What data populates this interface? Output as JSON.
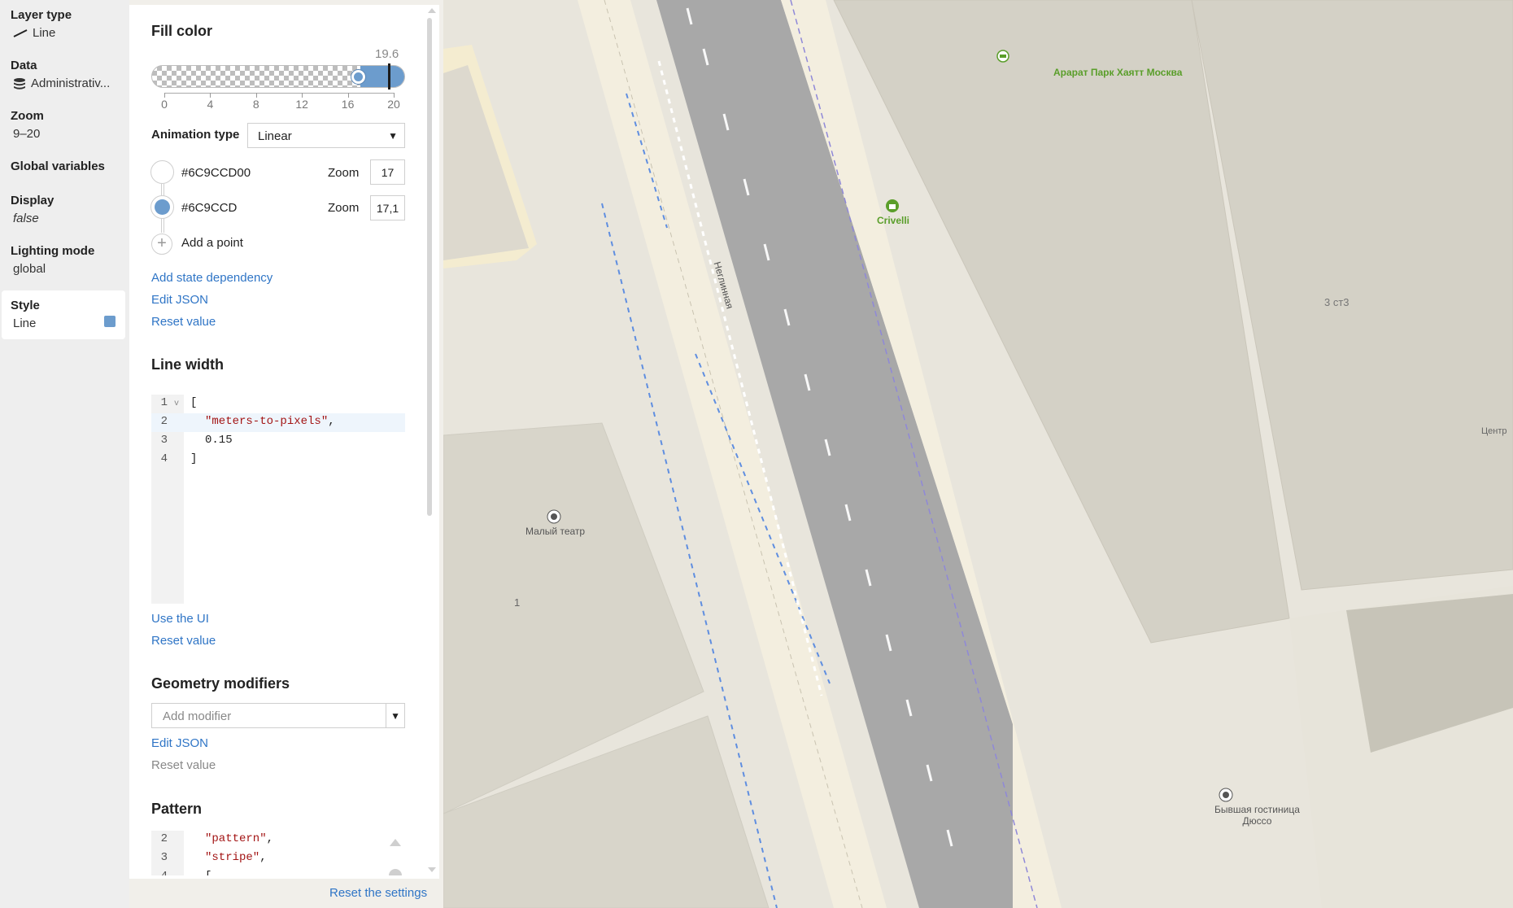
{
  "leftnav": {
    "layer_type": {
      "label": "Layer type",
      "value": "Line",
      "icon": "line-icon"
    },
    "data": {
      "label": "Data",
      "value": "Administrativ...",
      "icon": "database-icon"
    },
    "zoom": {
      "label": "Zoom",
      "value": "9–20"
    },
    "global_variables": {
      "label": "Global variables"
    },
    "display": {
      "label": "Display",
      "value": "false"
    },
    "lighting_mode": {
      "label": "Lighting mode",
      "value": "global"
    },
    "style": {
      "label": "Style",
      "value": "Line",
      "swatch_color": "#6C9CCD"
    }
  },
  "fill_color": {
    "title": "Fill color",
    "slider": {
      "value": "19.6",
      "ticks": [
        "0",
        "4",
        "8",
        "12",
        "16",
        "20"
      ],
      "min": 0,
      "max": 20,
      "current": 19.6,
      "fill_from": 17,
      "color": "#6C9CCD"
    },
    "animation_type_label": "Animation type",
    "animation_type_value": "Linear",
    "stops": [
      {
        "color": "#6C9CCD00",
        "zoom_label": "Zoom",
        "zoom": "17"
      },
      {
        "color": "#6C9CCD",
        "zoom_label": "Zoom",
        "zoom": "17,1"
      }
    ],
    "add_point_label": "Add a point",
    "add_state_dependency": "Add state dependency",
    "edit_json": "Edit JSON",
    "reset_value": "Reset value"
  },
  "line_width": {
    "title": "Line width",
    "code": {
      "line_numbers": [
        "1",
        "2",
        "3",
        "4"
      ],
      "l1": "[",
      "l2": "\"meters-to-pixels\"",
      "l2_suffix": ",",
      "l3": "0.15",
      "l4": "]"
    },
    "use_ui": "Use the UI",
    "reset_value": "Reset value"
  },
  "geometry_modifiers": {
    "title": "Geometry modifiers",
    "placeholder": "Add modifier",
    "edit_json": "Edit JSON",
    "reset_value": "Reset value"
  },
  "pattern": {
    "title": "Pattern",
    "code": {
      "line_numbers": [
        "2",
        "3",
        "4"
      ],
      "l2": "\"pattern\"",
      "l3": "\"stripe\"",
      "comma": ",",
      "l4": "["
    }
  },
  "footer": {
    "reset_settings": "Reset the settings"
  },
  "map": {
    "pois": [
      {
        "name": "Арарат Парк Хаятт Москва",
        "icon": "hotel-icon",
        "color": "#5a9e2a"
      },
      {
        "name": "Crivelli",
        "icon": "shop-icon",
        "color": "#5a9e2a"
      },
      {
        "name": "Малый театр",
        "icon": "theater-icon",
        "color": "#555555"
      },
      {
        "name": "Бывшая гостиница",
        "name2": "Дюссо",
        "icon": "monument-icon",
        "color": "#555555"
      }
    ],
    "street_name": "Неглинная",
    "building_number_1": "3 ст3",
    "building_number_2": "1",
    "edge_label": "Центр",
    "colors": {
      "road": "#a8a8a8",
      "sidewalk": "#f3eedf",
      "building": "#d4d1c6",
      "lane": "#6c9ccd"
    }
  }
}
